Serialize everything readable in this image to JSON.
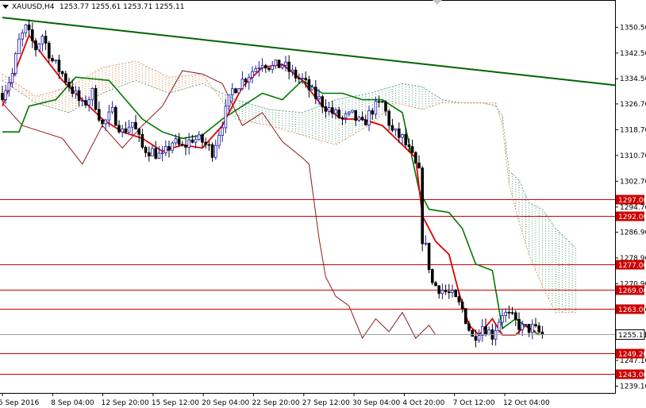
{
  "header": {
    "symbol_label": "XAUUSD,H4",
    "ohlc": "1253.77 1255.61 1253.71 1255.11"
  },
  "colors": {
    "background": "#ffffff",
    "frame": "#000000",
    "grid_level": "#cc0000",
    "level_label_bg": "#cc0000",
    "candle_up": "#1a1aa8",
    "candle_down": "#000000",
    "tenkan": "#e00000",
    "kijun": "#007700",
    "chikou": "#8b1a1a",
    "kumo_bear": "#d2691e",
    "kumo_bull": "#2e8b57",
    "trendline": "#006400"
  },
  "chart_data": {
    "type": "candlestick",
    "title": "XAUUSD,H4",
    "ylim": [
      1237.0,
      1355.5
    ],
    "y_ticks": [
      1350.5,
      1342.5,
      1334.5,
      1326.7,
      1318.7,
      1310.7,
      1302.7,
      1294.7,
      1286.9,
      1278.9,
      1270.9,
      1262.9,
      1247.1,
      1239.1
    ],
    "x_ticks": [
      "5 Sep 2016",
      "8 Sep 04:00",
      "12 Sep 20:00",
      "15 Sep 12:00",
      "20 Sep 04:00",
      "22 Sep 20:00",
      "27 Sep 12:00",
      "30 Sep 04:00",
      "4 Oct 20:00",
      "7 Oct 12:00",
      "12 Oct 04:00"
    ],
    "horizontal_levels": [
      1297.0,
      1292.0,
      1277.0,
      1269.0,
      1263.0,
      1249.2,
      1243.0
    ],
    "current_price": 1255.11,
    "price_waypoints": [
      [
        0,
        1330
      ],
      [
        3,
        1336
      ],
      [
        5,
        1346
      ],
      [
        7,
        1350
      ],
      [
        10,
        1344
      ],
      [
        12,
        1348
      ],
      [
        15,
        1340
      ],
      [
        18,
        1336
      ],
      [
        21,
        1331
      ],
      [
        24,
        1326
      ],
      [
        27,
        1330
      ],
      [
        30,
        1320
      ],
      [
        33,
        1324
      ],
      [
        36,
        1318
      ],
      [
        39,
        1321
      ],
      [
        42,
        1313
      ],
      [
        45,
        1312
      ],
      [
        48,
        1310
      ],
      [
        51,
        1315
      ],
      [
        54,
        1313
      ],
      [
        57,
        1316
      ],
      [
        60,
        1315
      ],
      [
        63,
        1312
      ],
      [
        66,
        1321
      ],
      [
        69,
        1331
      ],
      [
        72,
        1334
      ],
      [
        75,
        1337
      ],
      [
        78,
        1340
      ],
      [
        81,
        1338
      ],
      [
        84,
        1339
      ],
      [
        87,
        1336
      ],
      [
        90,
        1334
      ],
      [
        93,
        1330
      ],
      [
        96,
        1327
      ],
      [
        99,
        1324
      ],
      [
        102,
        1322
      ],
      [
        105,
        1323
      ],
      [
        108,
        1320
      ],
      [
        111,
        1325
      ],
      [
        114,
        1327
      ],
      [
        117,
        1318
      ],
      [
        120,
        1316
      ],
      [
        123,
        1310
      ],
      [
        125,
        1305
      ],
      [
        126,
        1285
      ],
      [
        127,
        1282
      ],
      [
        129,
        1271
      ],
      [
        132,
        1269
      ],
      [
        135,
        1267
      ],
      [
        138,
        1263
      ],
      [
        141,
        1254
      ],
      [
        144,
        1258
      ],
      [
        147,
        1255
      ],
      [
        150,
        1262
      ],
      [
        153,
        1260
      ],
      [
        156,
        1257
      ],
      [
        159,
        1257
      ],
      [
        162,
        1255
      ]
    ],
    "tenkan": [
      [
        0,
        1326
      ],
      [
        5,
        1340
      ],
      [
        8,
        1348
      ],
      [
        12,
        1342
      ],
      [
        18,
        1334
      ],
      [
        24,
        1328
      ],
      [
        30,
        1322
      ],
      [
        36,
        1318
      ],
      [
        42,
        1316
      ],
      [
        48,
        1312
      ],
      [
        54,
        1314
      ],
      [
        60,
        1313
      ],
      [
        66,
        1320
      ],
      [
        72,
        1332
      ],
      [
        78,
        1338
      ],
      [
        84,
        1339
      ],
      [
        90,
        1334
      ],
      [
        96,
        1326
      ],
      [
        102,
        1322
      ],
      [
        108,
        1322
      ],
      [
        114,
        1320
      ],
      [
        120,
        1314
      ],
      [
        124,
        1310
      ],
      [
        126,
        1292
      ],
      [
        130,
        1284
      ],
      [
        134,
        1280
      ],
      [
        137,
        1268
      ],
      [
        140,
        1258
      ],
      [
        143,
        1255
      ],
      [
        147,
        1260
      ],
      [
        150,
        1255
      ],
      [
        154,
        1255
      ],
      [
        157,
        1258
      ],
      [
        160,
        1256
      ]
    ],
    "kijun": [
      [
        0,
        1318
      ],
      [
        5,
        1318
      ],
      [
        8,
        1326
      ],
      [
        16,
        1328
      ],
      [
        22,
        1335
      ],
      [
        32,
        1334
      ],
      [
        37,
        1328
      ],
      [
        42,
        1322
      ],
      [
        48,
        1318
      ],
      [
        54,
        1316
      ],
      [
        60,
        1317
      ],
      [
        66,
        1322
      ],
      [
        72,
        1326
      ],
      [
        78,
        1330
      ],
      [
        84,
        1328
      ],
      [
        90,
        1334
      ],
      [
        96,
        1330
      ],
      [
        102,
        1330
      ],
      [
        108,
        1328
      ],
      [
        114,
        1328
      ],
      [
        120,
        1324
      ],
      [
        125,
        1300
      ],
      [
        128,
        1294
      ],
      [
        134,
        1293
      ],
      [
        138,
        1288
      ],
      [
        142,
        1277
      ],
      [
        147,
        1275
      ],
      [
        150,
        1257
      ],
      [
        154,
        1260
      ],
      [
        158,
        1257
      ],
      [
        161,
        1255
      ]
    ],
    "senkou_a": [
      [
        0,
        1334
      ],
      [
        10,
        1327
      ],
      [
        20,
        1324
      ],
      [
        30,
        1330
      ],
      [
        40,
        1334
      ],
      [
        50,
        1330
      ],
      [
        60,
        1333
      ],
      [
        70,
        1328
      ],
      [
        80,
        1325
      ],
      [
        90,
        1324
      ],
      [
        100,
        1328
      ],
      [
        110,
        1330
      ],
      [
        120,
        1333
      ],
      [
        126,
        1332
      ],
      [
        132,
        1328
      ],
      [
        138,
        1327
      ],
      [
        144,
        1327
      ],
      [
        148,
        1326
      ],
      [
        150,
        1323
      ],
      [
        152,
        1306
      ],
      [
        155,
        1303
      ],
      [
        158,
        1296
      ],
      [
        162,
        1294
      ],
      [
        166,
        1288
      ],
      [
        172,
        1282
      ]
    ],
    "senkou_b": [
      [
        0,
        1336
      ],
      [
        10,
        1329
      ],
      [
        20,
        1332
      ],
      [
        30,
        1338
      ],
      [
        40,
        1340
      ],
      [
        50,
        1335
      ],
      [
        60,
        1336
      ],
      [
        70,
        1322
      ],
      [
        80,
        1320
      ],
      [
        90,
        1317
      ],
      [
        100,
        1314
      ],
      [
        110,
        1320
      ],
      [
        118,
        1327
      ],
      [
        126,
        1325
      ],
      [
        132,
        1327
      ],
      [
        138,
        1327
      ],
      [
        144,
        1327
      ],
      [
        148,
        1327
      ],
      [
        150,
        1320
      ],
      [
        152,
        1302
      ],
      [
        155,
        1290
      ],
      [
        158,
        1280
      ],
      [
        162,
        1270
      ],
      [
        166,
        1262
      ],
      [
        172,
        1262
      ]
    ],
    "chikou": [
      [
        0,
        1327
      ],
      [
        6,
        1320
      ],
      [
        12,
        1318
      ],
      [
        18,
        1316
      ],
      [
        24,
        1308
      ],
      [
        30,
        1320
      ],
      [
        36,
        1313
      ],
      [
        42,
        1320
      ],
      [
        48,
        1326
      ],
      [
        54,
        1337
      ],
      [
        60,
        1336
      ],
      [
        66,
        1333
      ],
      [
        72,
        1320
      ],
      [
        78,
        1324
      ],
      [
        84,
        1315
      ],
      [
        90,
        1310
      ],
      [
        92,
        1308
      ],
      [
        95,
        1285
      ],
      [
        97,
        1273
      ],
      [
        100,
        1267
      ],
      [
        104,
        1264
      ],
      [
        108,
        1254
      ],
      [
        112,
        1260
      ],
      [
        116,
        1256
      ],
      [
        120,
        1262
      ],
      [
        124,
        1254
      ],
      [
        128,
        1258
      ],
      [
        130,
        1255
      ]
    ],
    "trendline": [
      [
        0,
        1353.5
      ],
      [
        169,
        1334.2
      ]
    ]
  }
}
